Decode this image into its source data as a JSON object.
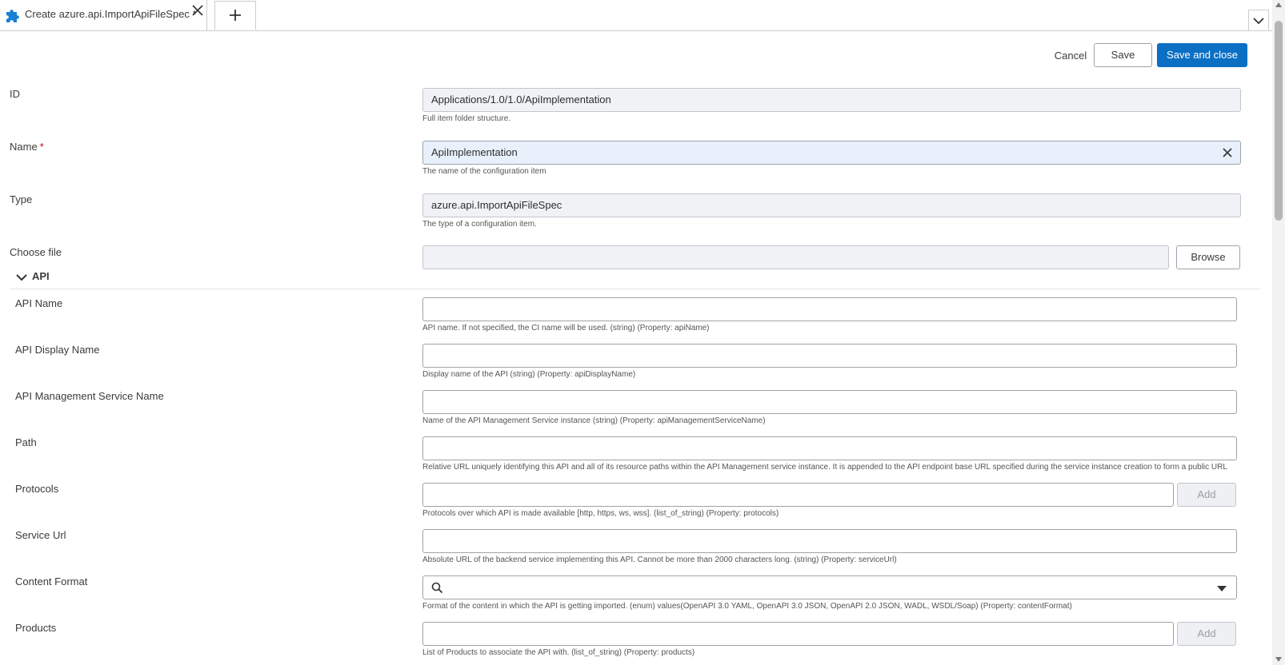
{
  "tab": {
    "title": "Create azure.api.ImportApiFileSpec *",
    "icon": "puzzle-icon",
    "add_icon": "plus-icon",
    "overflow_icon": "chevron-down-icon"
  },
  "actions": {
    "cancel": "Cancel",
    "save": "Save",
    "save_close": "Save and close"
  },
  "colors": {
    "primary": "#0b6fc4",
    "required": "#d0021b",
    "tab_icon": "#1a7fd4"
  },
  "fields": {
    "id": {
      "label": "ID",
      "value": "Applications/1.0/1.0/ApiImplementation",
      "help": "Full item folder structure."
    },
    "name": {
      "label": "Name",
      "required_mark": "*",
      "value": "ApiImplementation",
      "help": "The name of the configuration item"
    },
    "type": {
      "label": "Type",
      "value": "azure.api.ImportApiFileSpec",
      "help": "The type of a configuration item."
    },
    "choose_file": {
      "label": "Choose file",
      "value": "",
      "browse": "Browse"
    }
  },
  "section": {
    "title": "API",
    "fields": {
      "api_name": {
        "label": "API Name",
        "value": "",
        "help": "API name. If not specified, the CI name will be used. (string) (Property: apiName)"
      },
      "api_display_name": {
        "label": "API Display Name",
        "value": "",
        "help": "Display name of the API (string) (Property: apiDisplayName)"
      },
      "api_mgmt_service": {
        "label": "API Management Service Name",
        "value": "",
        "help": "Name of the API Management Service instance (string) (Property: apiManagementServiceName)"
      },
      "path": {
        "label": "Path",
        "value": "",
        "help": "Relative URL uniquely identifying this API and all of its resource paths within the API Management service instance. It is appended to the API endpoint base URL specified during the service instance creation to form a public URL"
      },
      "protocols": {
        "label": "Protocols",
        "value": "",
        "add": "Add",
        "help": "Protocols over which API is made available [http, https, ws, wss]. (list_of_string) (Property: protocols)"
      },
      "service_url": {
        "label": "Service Url",
        "value": "",
        "help": "Absolute URL of the backend service implementing this API. Cannot be more than 2000 characters long. (string) (Property: serviceUrl)"
      },
      "content_format": {
        "label": "Content Format",
        "value": "",
        "help": "Format of the content in which the API is getting imported. (enum) values(OpenAPI 3.0 YAML, OpenAPI 3.0 JSON, OpenAPI 2.0 JSON, WADL, WSDL/Soap) (Property: contentFormat)"
      },
      "products": {
        "label": "Products",
        "value": "",
        "add": "Add",
        "help": "List of Products to associate the API with. (list_of_string) (Property: products)"
      }
    }
  }
}
